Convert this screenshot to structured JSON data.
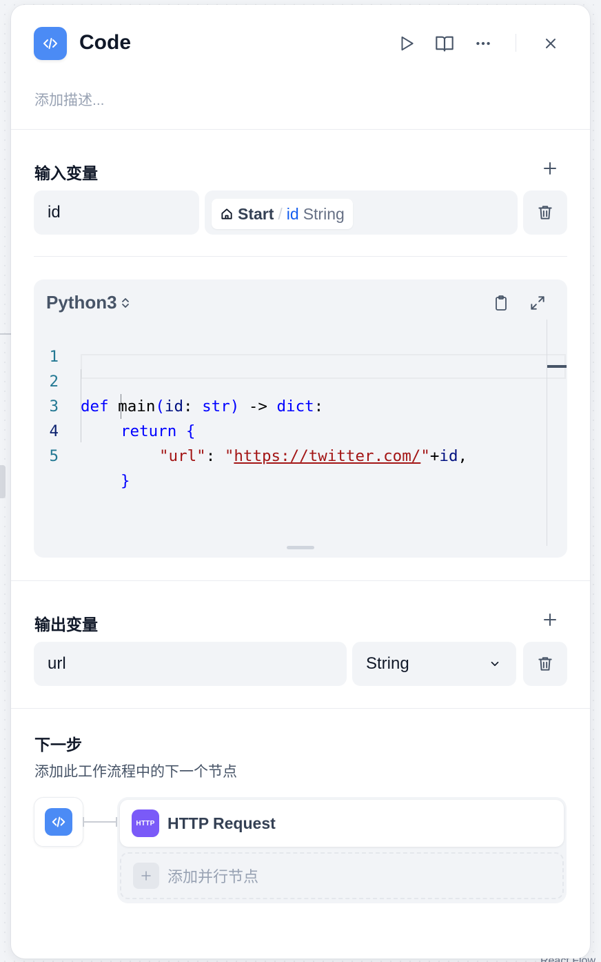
{
  "background": {
    "canvas_hint": "React Flow"
  },
  "header": {
    "title": "Code",
    "description_placeholder": "添加描述...",
    "icon": "code-icon",
    "actions": [
      "run-icon",
      "book-icon",
      "more-icon",
      "close-icon"
    ]
  },
  "input_vars": {
    "title": "输入变量",
    "items": [
      {
        "name": "id",
        "source_node": "Start",
        "source_sep": "/",
        "source_var": "id",
        "source_type": "String"
      }
    ]
  },
  "code_editor": {
    "language": "Python3",
    "lines": [
      {
        "num": "1"
      },
      {
        "num": "2",
        "kw1": "def",
        "fn": " main",
        "p1": "(",
        "arg": "id",
        "colon": ": ",
        "type": "str",
        "p2": ")",
        "arrow": " -> ",
        "ret": "dict",
        "end": ":"
      },
      {
        "num": "3",
        "kw": "return",
        "brace": " {"
      },
      {
        "num": "4",
        "key": "\"url\"",
        "sep": ": ",
        "q": "\"",
        "url": "https://twitter.com/",
        "q2": "\"",
        "plus": "+",
        "var": "id",
        "comma": ","
      },
      {
        "num": "5",
        "brace": "}"
      }
    ]
  },
  "output_vars": {
    "title": "输出变量",
    "items": [
      {
        "name": "url",
        "type": "String"
      }
    ]
  },
  "next_step": {
    "title": "下一步",
    "subtitle": "添加此工作流程中的下一个节点",
    "nodes": [
      {
        "icon_text": "HTTP",
        "label": "HTTP Request"
      }
    ],
    "add_parallel_label": "添加并行节点"
  },
  "colors": {
    "accent": "#4b8bf5",
    "http": "#7a5af8",
    "link": "#155eef"
  }
}
